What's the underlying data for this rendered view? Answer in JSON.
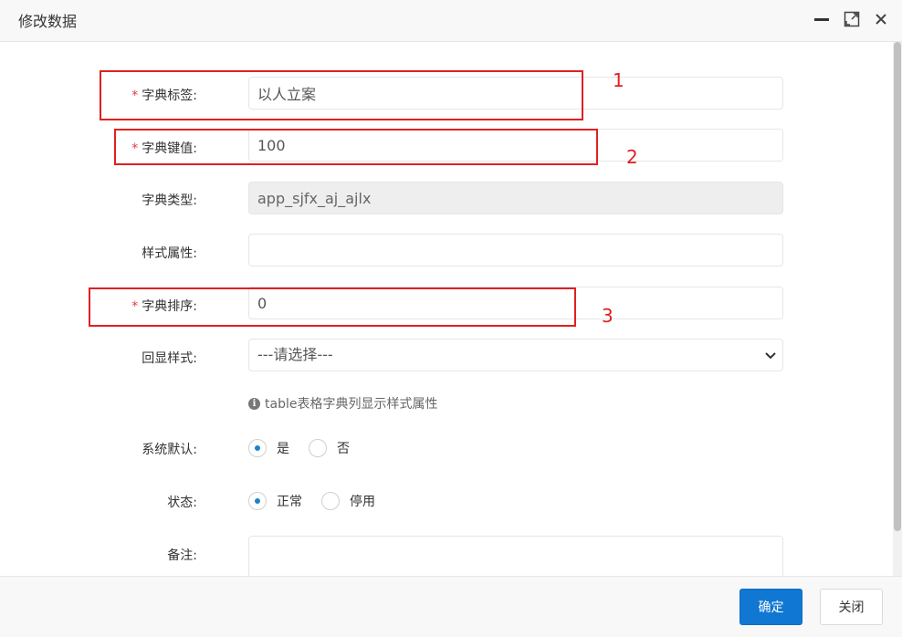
{
  "dialog": {
    "title": "修改数据",
    "icons": {
      "minimize": "minimize-icon",
      "maximize": "maximize-icon",
      "close": "close-icon"
    }
  },
  "form": {
    "required_mark": "*",
    "dict_label": {
      "label": "字典标签:",
      "value": "以人立案",
      "required": true
    },
    "dict_value": {
      "label": "字典键值:",
      "value": "100",
      "required": true
    },
    "dict_type": {
      "label": "字典类型:",
      "value": "app_sjfx_aj_ajlx",
      "readonly": true
    },
    "css_class": {
      "label": "样式属性:",
      "value": ""
    },
    "dict_sort": {
      "label": "字典排序:",
      "value": "0",
      "required": true
    },
    "list_class": {
      "label": "回显样式:",
      "selected": "---请选择---"
    },
    "list_class_hint": "table表格字典列显示样式属性",
    "is_default": {
      "label": "系统默认:",
      "options": [
        "是",
        "否"
      ],
      "selected": "是"
    },
    "status": {
      "label": "状态:",
      "options": [
        "正常",
        "停用"
      ],
      "selected": "正常"
    },
    "remark": {
      "label": "备注:",
      "value": ""
    }
  },
  "annotations": [
    "1",
    "2",
    "3"
  ],
  "annotation_color": "#e02020",
  "accent_color": "#1077d2",
  "footer": {
    "confirm_label": "确定",
    "close_label": "关闭"
  }
}
